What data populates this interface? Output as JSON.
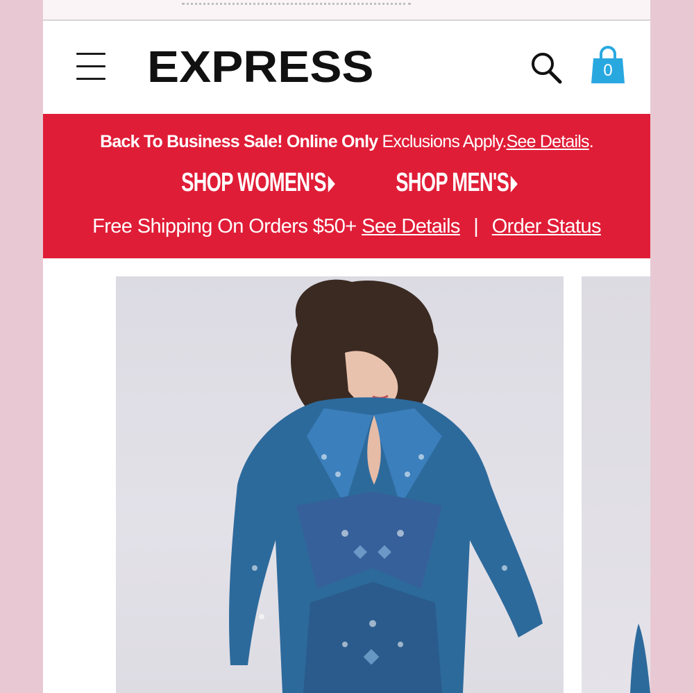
{
  "header": {
    "logo": "EXPRESS",
    "bag_count": "0"
  },
  "promo": {
    "sale_bold": "Back To Business Sale! Online Only",
    "sale_text": "Exclusions Apply.",
    "sale_link": "See Details",
    "sale_period": ".",
    "shop_women": "SHOP WOMEN'S",
    "shop_men": "SHOP MEN'S",
    "shipping_text": "Free Shipping On Orders $50+",
    "shipping_link": "See Details",
    "separator": "|",
    "order_status": "Order Status"
  },
  "colors": {
    "promo_bg": "#e01d37",
    "bag": "#29a8e0",
    "page_bg": "#e8c9d3"
  },
  "icons": {
    "menu": "hamburger-menu-icon",
    "search": "search-icon",
    "bag": "shopping-bag-icon"
  }
}
